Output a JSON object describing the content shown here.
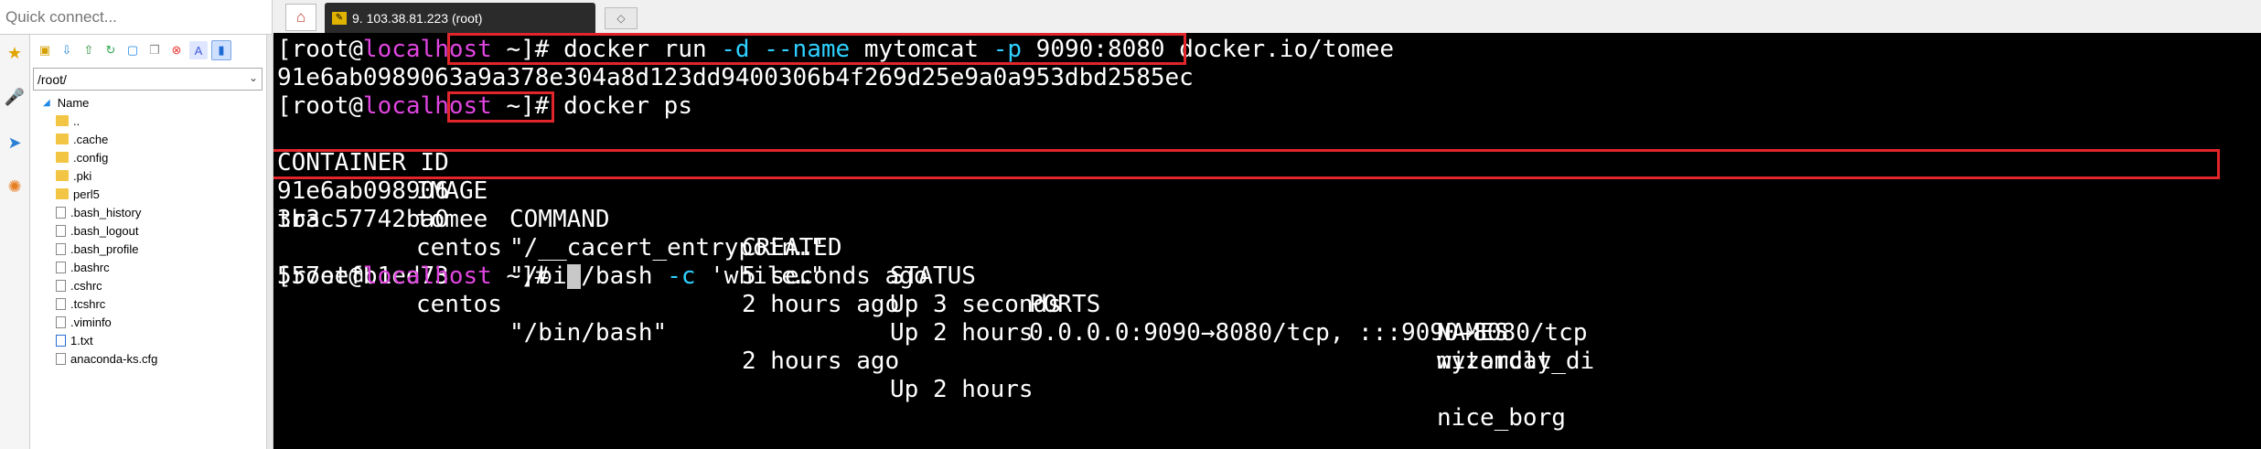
{
  "quick_connect": {
    "placeholder": "Quick connect..."
  },
  "file_panel": {
    "path": "/root/",
    "header": "Name",
    "items": [
      {
        "name": "..",
        "type": "folder"
      },
      {
        "name": ".cache",
        "type": "folder"
      },
      {
        "name": ".config",
        "type": "folder"
      },
      {
        "name": ".pki",
        "type": "folder"
      },
      {
        "name": "perl5",
        "type": "folder"
      },
      {
        "name": ".bash_history",
        "type": "file"
      },
      {
        "name": ".bash_logout",
        "type": "file"
      },
      {
        "name": ".bash_profile",
        "type": "file"
      },
      {
        "name": ".bashrc",
        "type": "file"
      },
      {
        "name": ".cshrc",
        "type": "file"
      },
      {
        "name": ".tcshrc",
        "type": "file"
      },
      {
        "name": ".viminfo",
        "type": "file"
      },
      {
        "name": "1.txt",
        "type": "file"
      },
      {
        "name": "anaconda-ks.cfg",
        "type": "file"
      }
    ]
  },
  "tabs": {
    "active_label": "9. 103.38.81.223 (root)"
  },
  "terminal": {
    "prompt": {
      "open": "[root@",
      "host": "localhost",
      "close": " ~]# "
    },
    "cmd1": {
      "a": "docker run ",
      "o1": "-d",
      "b": " ",
      "o2": "--name",
      "c": " mytomcat ",
      "o3": "-p",
      "d": " 9090:8080 docker.io/tomee"
    },
    "container_id_full": "91e6ab0989063a9a378e304a8d123dd9400306b4f269d25e9a0a953dbd2585ec",
    "cmd2": "docker ps",
    "headers": [
      "CONTAINER ID",
      "IMAGE",
      "COMMAND",
      "CREATED",
      "STATUS",
      "PORTS",
      "NAMES"
    ],
    "rows": [
      [
        "91e6ab098906",
        "tomee",
        "\"/__cacert_entrypoin…\"",
        "5 seconds ago",
        "Up 3 seconds",
        "0.0.0.0:9090→8080/tcp, :::9090→8080/tcp",
        "mytomcat"
      ],
      [
        "3b3c57742ba0",
        "centos",
        "\"/bin/bash -c 'while…\"",
        "2 hours ago",
        "Up 2 hours",
        "",
        "wizardly_di"
      ],
      [
        "557eefb1ed73",
        "centos",
        "\"/bin/bash\"",
        "2 hours ago",
        "Up 2 hours",
        "",
        "nice_borg"
      ]
    ],
    "wrap_text": "tra",
    "row2_cmd": {
      "a": "\"/bin/bash ",
      "opt": "-c",
      "b": " 'while…\""
    },
    "highlight_color": "#e0262a"
  }
}
